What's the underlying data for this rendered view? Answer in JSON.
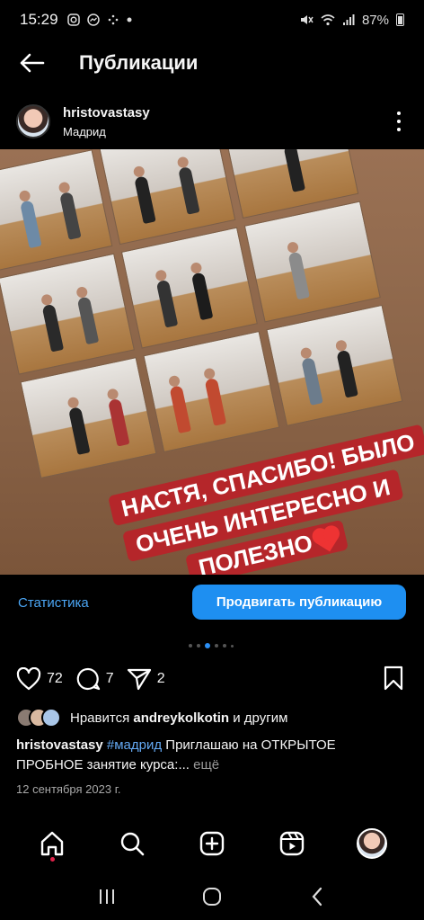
{
  "status_bar": {
    "time": "15:29",
    "battery": "87%",
    "icons": [
      "instagram-icon",
      "messenger-icon",
      "dots-icon",
      "mute-icon",
      "wifi-icon",
      "signal-icon",
      "battery-icon"
    ]
  },
  "header": {
    "title": "Публикации"
  },
  "post": {
    "username": "hristovastasy",
    "location": "Мадрид",
    "photo_text_lines": [
      "НАСТЯ, СПАСИБО! БЫЛО",
      "ОЧЕНЬ ИНТЕРЕСНО И",
      "ПОЛЕЗНО"
    ],
    "statistics_label": "Статистика",
    "promote_label": "Продвигать публикацию",
    "carousel": {
      "count": 6,
      "active": 2
    },
    "likes_count": "72",
    "comments_count": "7",
    "shares_count": "2",
    "liked_by_prefix": "Нравится",
    "liked_by_user": "andreykolkotin",
    "liked_by_suffix": "и другим",
    "caption_user": "hristovastasy",
    "caption_tag": "#мадрид",
    "caption_text": " Приглашаю на ОТКРЫТОЕ ПРОБНОЕ занятие курса:...",
    "caption_more": " ещё",
    "date": "12 сентября 2023 г."
  },
  "colors": {
    "accent": "#1e8ff1",
    "link": "#4ba6f5",
    "banner": "#b5262a",
    "notification_dot": "#e0224a"
  },
  "nav": [
    "home-icon",
    "search-icon",
    "create-icon",
    "reels-icon",
    "profile-avatar"
  ]
}
